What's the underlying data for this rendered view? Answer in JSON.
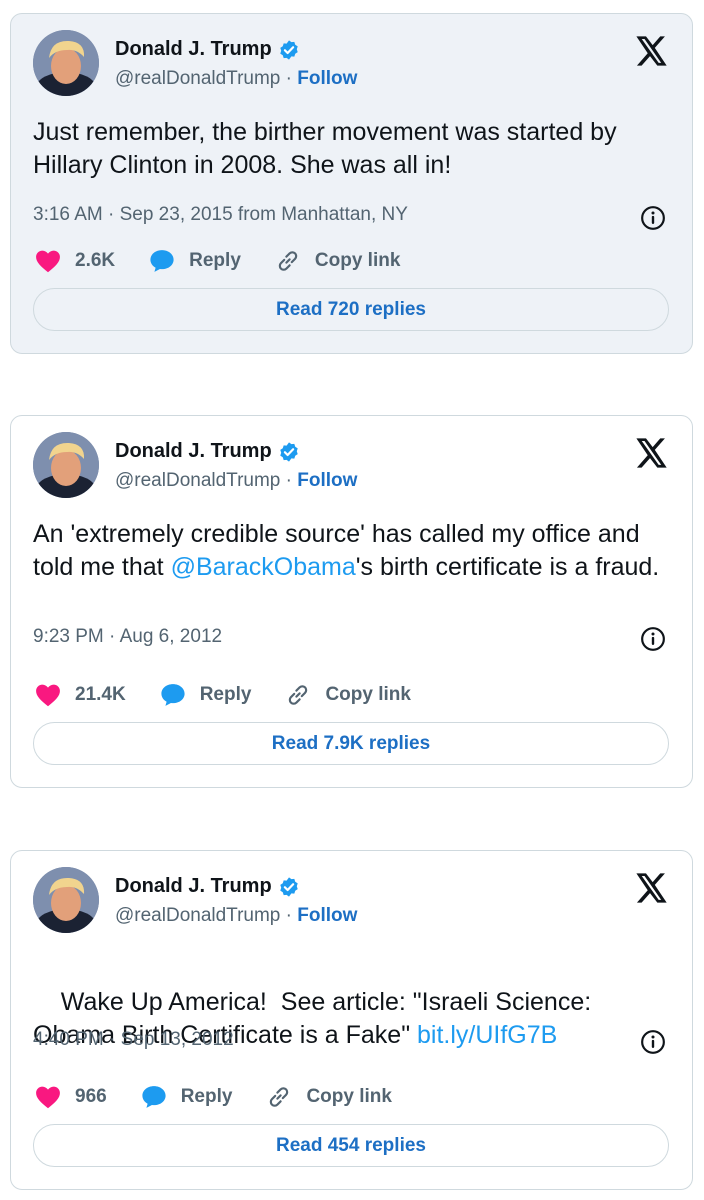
{
  "tweets": [
    {
      "author_name": "Donald J. Trump",
      "handle": "@realDonaldTrump",
      "separator": " · ",
      "follow_label": "Follow",
      "text_parts": [
        "Just remember, the birther movement was started by Hillary Clinton in 2008. She was all in!"
      ],
      "timestamp": "3:16 AM · Sep 23, 2015 from Manhattan, NY",
      "likes": "2.6K",
      "reply_label": "Reply",
      "copy_label": "Copy link",
      "read_replies_label": "Read 720 replies"
    },
    {
      "author_name": "Donald J. Trump",
      "handle": "@realDonaldTrump",
      "separator": " · ",
      "follow_label": "Follow",
      "text_parts": [
        "An 'extremely credible source' has called my office and told me that ",
        "@BarackObama",
        "'s birth certificate is a fraud."
      ],
      "timestamp": "9:23 PM · Aug 6, 2012",
      "likes": "21.4K",
      "reply_label": "Reply",
      "copy_label": "Copy link",
      "read_replies_label": "Read 7.9K replies"
    },
    {
      "author_name": "Donald J. Trump",
      "handle": "@realDonaldTrump",
      "separator": " · ",
      "follow_label": "Follow",
      "text_parts": [
        "Wake Up America!  See article: \"Israeli Science: Obama Birth Certificate is a Fake\" ",
        "bit.ly/UIfG7B"
      ],
      "timestamp": "4:40 PM · Sep 13, 2012",
      "likes": "966",
      "reply_label": "Reply",
      "copy_label": "Copy link",
      "read_replies_label": "Read 454 replies"
    }
  ],
  "colors": {
    "link": "#1d9bf0",
    "follow": "#1d6fc4",
    "heart": "#f91880",
    "reply_bubble": "#1d9bf0",
    "secondary_text": "#536471",
    "highlight_bg": "#eef2f7",
    "border": "#cfd9de"
  },
  "icons": [
    "verified-badge-icon",
    "x-logo-icon",
    "info-icon",
    "heart-icon",
    "reply-bubble-icon",
    "link-icon"
  ]
}
